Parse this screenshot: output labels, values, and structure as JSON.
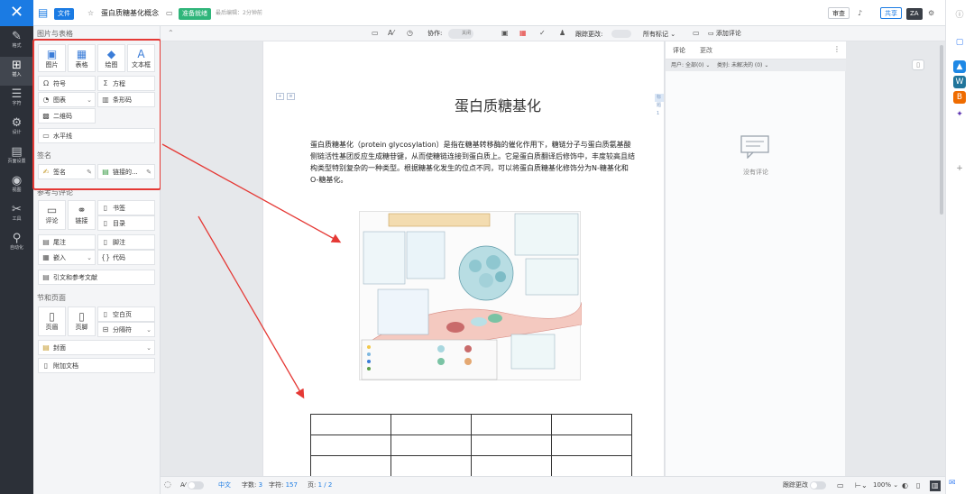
{
  "app": {
    "logo_glyph": "✕"
  },
  "leftbar": {
    "items": [
      {
        "icon": "✎",
        "label": "格式"
      },
      {
        "icon": "⊞",
        "label": "插入"
      },
      {
        "icon": "☰",
        "label": "字符"
      },
      {
        "icon": "⚙",
        "label": "设计"
      },
      {
        "icon": "▤",
        "label": "页面设置"
      },
      {
        "icon": "◉",
        "label": "视图"
      },
      {
        "icon": "✂",
        "label": "工具"
      },
      {
        "icon": "⚲",
        "label": "自动化"
      }
    ]
  },
  "topbar": {
    "file_menu": "文件",
    "doc_title": "蛋白质糖基化概念",
    "status_badge": "准备就绪",
    "last_edit": "最后编辑：2分钟前",
    "review_label": "审查",
    "share_label": "共享",
    "avatar": "ZA",
    "notification_count": "9"
  },
  "panel": {
    "section_images": "图片与表格",
    "big_buttons": [
      {
        "icon": "▣",
        "label": "图片"
      },
      {
        "icon": "▦",
        "label": "表格"
      },
      {
        "icon": "◆",
        "label": "绘图"
      },
      {
        "icon": "A",
        "label": "文本框"
      }
    ],
    "rows1": [
      {
        "icon": "Ω",
        "label": "符号"
      },
      {
        "icon": "Σ",
        "label": "方程"
      },
      {
        "icon": "◔",
        "label": "图表"
      },
      {
        "icon": "▥",
        "label": "条形码"
      }
    ],
    "qrcode": "二维码",
    "hline": "水平线",
    "section_signature": "签名",
    "signature": "签名",
    "link_field": "链接的...",
    "section_refs": "参考与评论",
    "comment": "评论",
    "link": "链接",
    "bookmark": "书签",
    "toc": "目录",
    "footnote_tail": "尾注",
    "footnote": "脚注",
    "embed": "嵌入",
    "code": "代码",
    "citation": "引文和参考文献",
    "section_pages": "节和页面",
    "header": "页眉",
    "footer": "页脚",
    "blank_page": "空白页",
    "separator": "分隔符",
    "cover": "封面",
    "attach_doc": "附加文档"
  },
  "doctoolbar": {
    "collab": "协作:",
    "collab_toggle": "关闭",
    "track_changes": "跟踪更改:",
    "all_marks": "所有标记",
    "add_comment": "添加评论"
  },
  "document": {
    "title": "蛋白质糖基化",
    "paragraph": "蛋白质糖基化（protein glycosylation）是指在糖基转移酶的催化作用下，糖链分子与蛋白质氨基酸侧链活性基团反应生成糖苷键，从而使糖链连接到蛋白质上。它是蛋白质翻译后修饰中，丰度较高且结构类型特别复杂的一种类型。根据糖基化发生的位点不同，可以将蛋白质糖基化修饰分为N-糖基化和O-糖基化。",
    "corner_tag": "标题1"
  },
  "comments": {
    "tab_comments": "评论",
    "tab_changes": "更改",
    "filter_user_label": "用户:",
    "filter_user_value": "全部(0)",
    "filter_status_label": "类别:",
    "filter_status_value": "未解决的 (0)",
    "empty": "没有评论"
  },
  "statusbar": {
    "lang": "中文",
    "word_count_label": "字数:",
    "word_count": "3",
    "char_count_label": "字符:",
    "char_count": "157",
    "page_label": "页:",
    "page_value": "1 / 2",
    "track_label": "跟踪更改",
    "zoom": "100%"
  },
  "colors": {
    "accent": "#1b7be3",
    "highlight_box": "#e53935",
    "status_badge": "#2fb57a"
  }
}
